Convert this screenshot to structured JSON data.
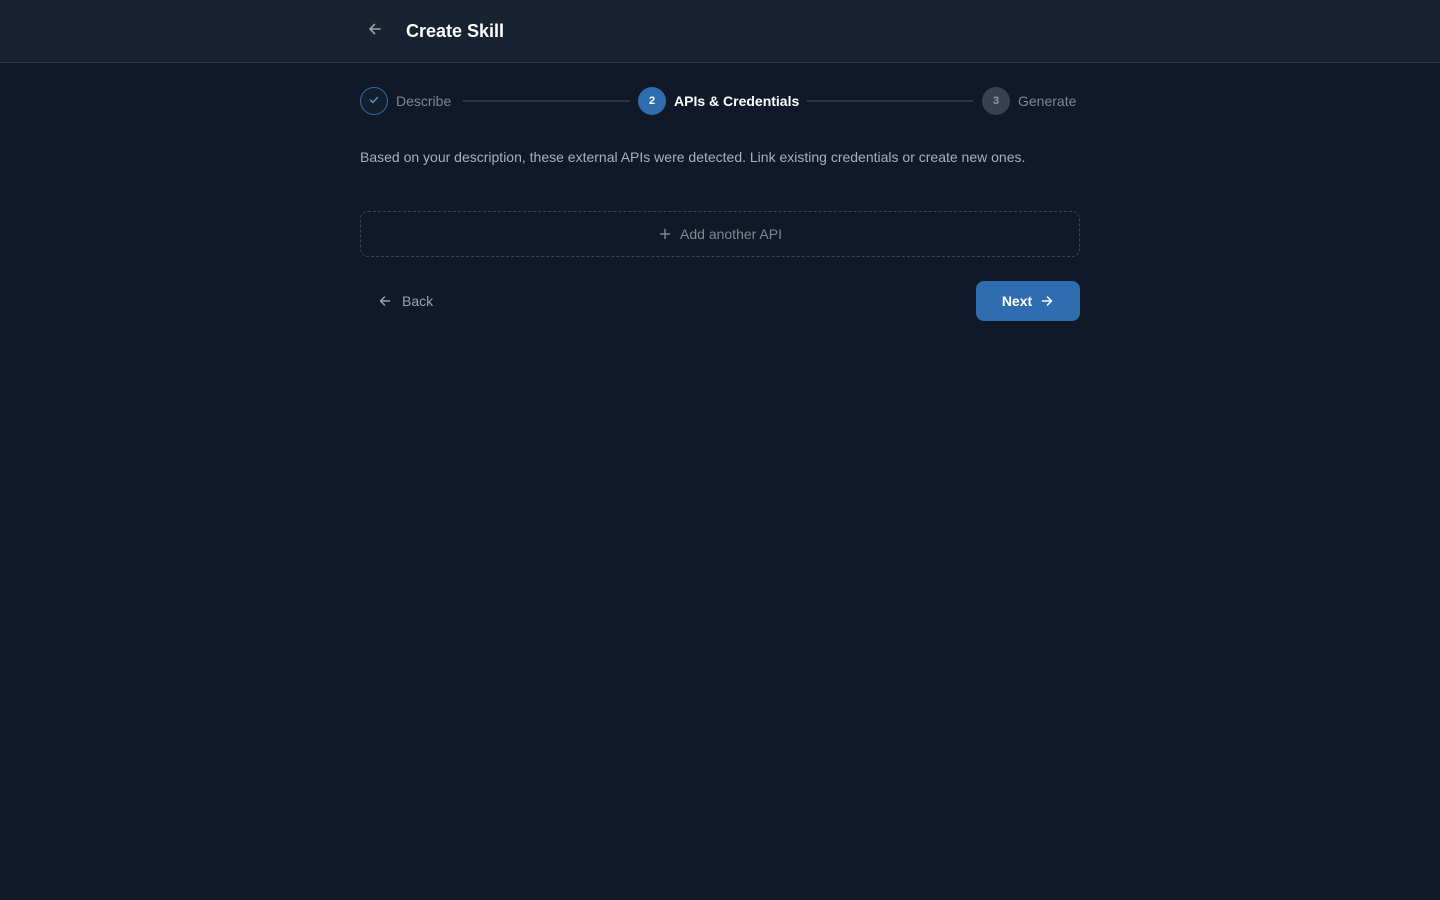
{
  "header": {
    "title": "Create Skill",
    "back_icon": "arrow-left-icon"
  },
  "stepper": {
    "steps": [
      {
        "number": "1",
        "label": "Describe",
        "state": "done",
        "icon": "check-icon"
      },
      {
        "number": "2",
        "label": "APIs & Credentials",
        "state": "active"
      },
      {
        "number": "3",
        "label": "Generate",
        "state": "pending"
      }
    ]
  },
  "main": {
    "description": "Based on your description, these external APIs were detected. Link existing credentials or create new ones.",
    "add_api_label": "Add another API",
    "add_api_icon": "plus-icon"
  },
  "footer": {
    "back_label": "Back",
    "back_icon": "arrow-left-icon",
    "next_label": "Next",
    "next_icon": "arrow-right-icon"
  },
  "colors": {
    "background": "#111827",
    "header_background": "#192231",
    "accent": "#2f6db0",
    "muted_text": "#7d8796"
  }
}
